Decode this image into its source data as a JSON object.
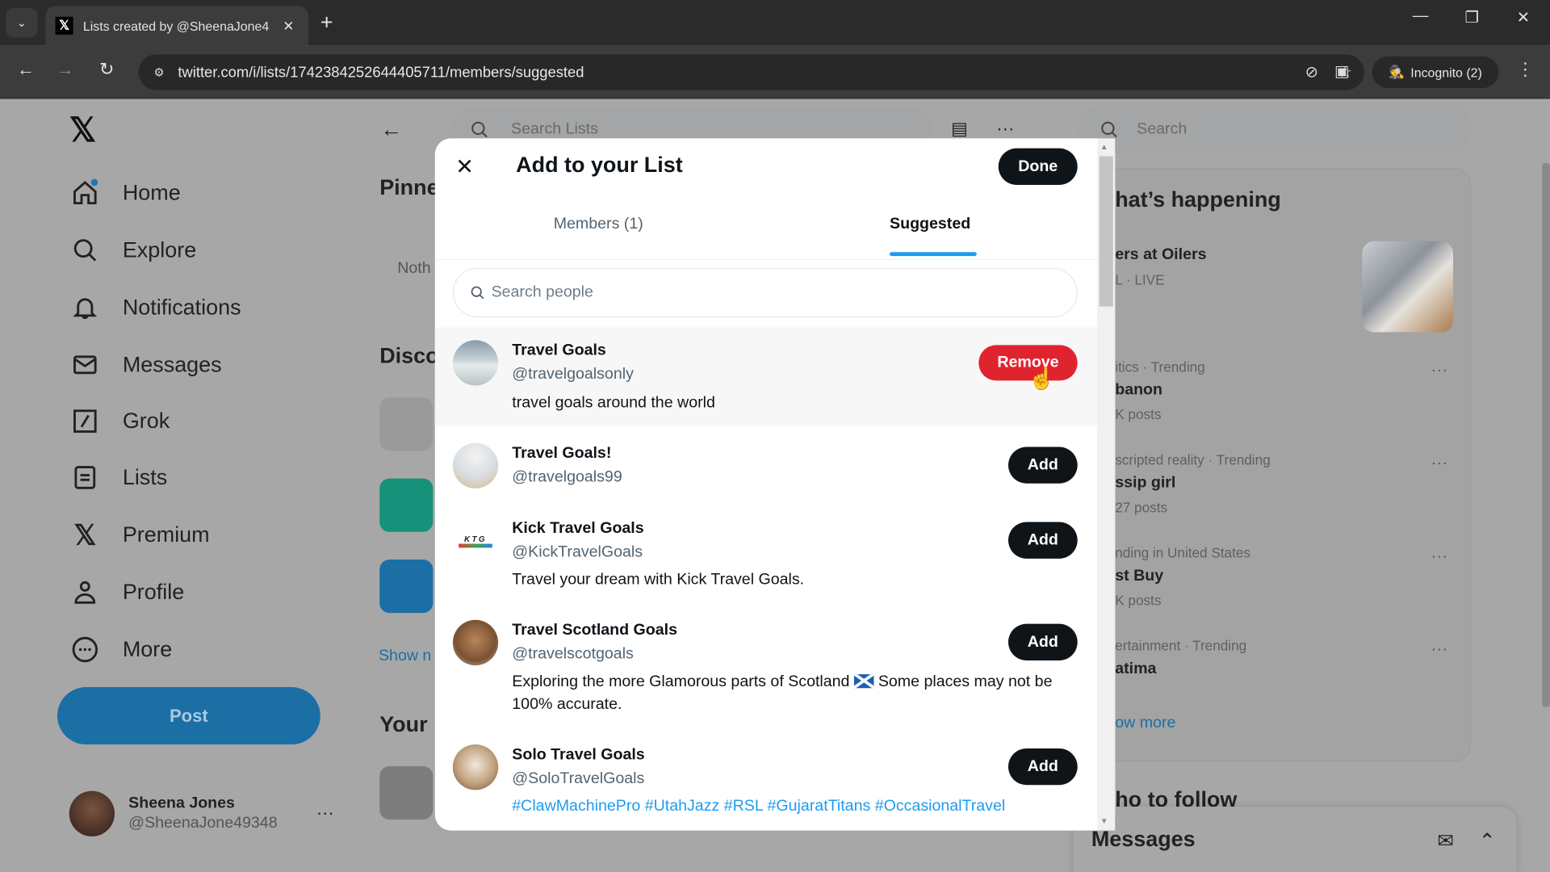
{
  "browser": {
    "tab_title": "Lists created by @SheenaJone4",
    "url": "twitter.com/i/lists/1742384252644405711/members/suggested",
    "incognito_label": "Incognito (2)",
    "new_tab": "+"
  },
  "sidebar": {
    "items": [
      {
        "label": "Home",
        "icon": "home-icon"
      },
      {
        "label": "Explore",
        "icon": "search-icon"
      },
      {
        "label": "Notifications",
        "icon": "bell-icon"
      },
      {
        "label": "Messages",
        "icon": "mail-icon"
      },
      {
        "label": "Grok",
        "icon": "grok-icon"
      },
      {
        "label": "Lists",
        "icon": "list-icon"
      },
      {
        "label": "Premium",
        "icon": "x-icon"
      },
      {
        "label": "Profile",
        "icon": "person-icon"
      },
      {
        "label": "More",
        "icon": "more-circle-icon"
      }
    ],
    "post_label": "Post",
    "account": {
      "name": "Sheena Jones",
      "handle": "@SheenaJone49348"
    }
  },
  "middle": {
    "search_placeholder": "Search Lists",
    "pinned_heading": "Pinne",
    "nothing_text": "Noth",
    "discover_heading": "Disco",
    "show_more": "Show n",
    "your_heading": "Your"
  },
  "right": {
    "search_placeholder": "Search",
    "whats_happening": "hat’s happening",
    "trends": [
      {
        "meta": "L · LIVE",
        "name": "ers at Oilers",
        "posts": ""
      },
      {
        "meta": "itics · Trending",
        "name": "banon",
        "posts": "K posts"
      },
      {
        "meta": "scripted reality · Trending",
        "name": "ssip girl",
        "posts": "27 posts"
      },
      {
        "meta": "nding in United States",
        "name": "st Buy",
        "posts": "K posts"
      },
      {
        "meta": "ertainment · Trending",
        "name": "atima",
        "posts": ""
      }
    ],
    "show_more": "ow more",
    "who_to_follow": "ho to follow",
    "messages_drawer": "Messages"
  },
  "modal": {
    "title": "Add to your List",
    "done_label": "Done",
    "tabs": [
      {
        "label": "Members (1)",
        "active": false
      },
      {
        "label": "Suggested",
        "active": true
      }
    ],
    "search_placeholder": "Search people",
    "people": [
      {
        "name": "Travel Goals",
        "handle": "@travelgoalsonly",
        "bio": "travel goals around the world",
        "action": "Remove",
        "highlighted": true
      },
      {
        "name": "Travel Goals!",
        "handle": "@travelgoals99",
        "bio": "",
        "action": "Add"
      },
      {
        "name": "Kick Travel Goals",
        "handle": "@KickTravelGoals",
        "bio": "Travel your dream with Kick Travel Goals.",
        "action": "Add"
      },
      {
        "name": "Travel Scotland Goals",
        "handle": "@travelscotgoals",
        "bio_before": "Exploring the more Glamorous parts of Scotland",
        "bio_after": "Some places may not be 100% accurate.",
        "action": "Add"
      },
      {
        "name": "Solo Travel Goals",
        "handle": "@SoloTravelGoals",
        "hashtags": [
          "#ClawMachinePro",
          "#UtahJazz",
          "#RSL",
          "#GujaratTitans",
          "#OccasionalTravel"
        ],
        "action": "Add"
      }
    ]
  },
  "colors": {
    "accent_blue": "#1d9bf0",
    "remove_red": "#e0242f",
    "button_dark": "#0f1419"
  }
}
